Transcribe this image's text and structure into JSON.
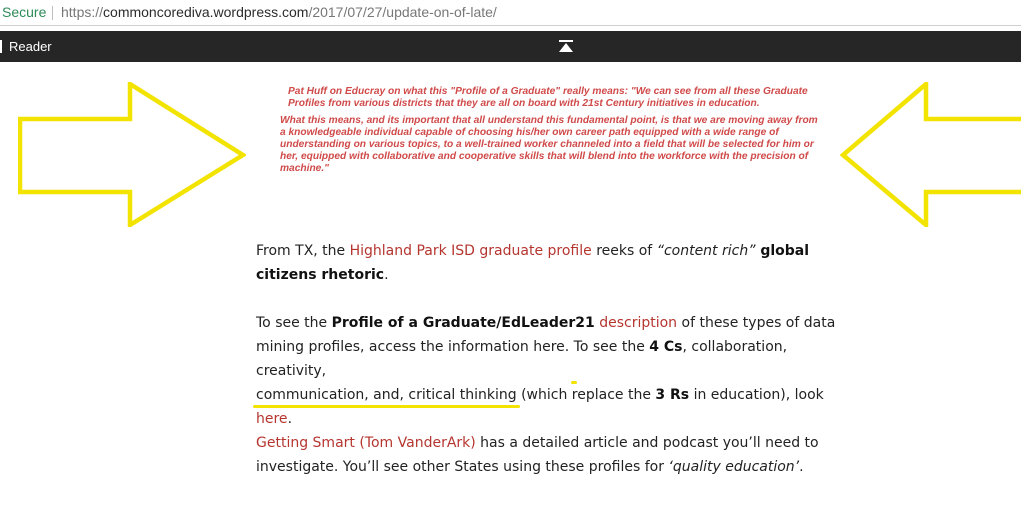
{
  "address_bar": {
    "secure_label": "Secure",
    "url_scheme": "https://",
    "url_host": "commoncorediva.wordpress.com",
    "url_path": "/2017/07/27/update-on-of-late/"
  },
  "reader_bar": {
    "label": "Reader",
    "collapse_icon": "collapse-up-icon"
  },
  "quote_image": {
    "paragraph1": "Pat Huff on Educray on what this \"Profile of a Graduate\" really means: \"We can see from all these Graduate Profiles from various districts that they are all on board with 21st Century initiatives in education.",
    "paragraph2": "What this means, and its important that all understand this fundamental point, is that we are moving away from a knowledgeable individual capable of choosing his/her own career path equipped with a wide range of understanding on various topics, to a well-trained worker channeled into a field that will be selected for him or her, equipped with collaborative and cooperative skills that will blend into the workforce with the precision of machine.\"",
    "text_color": "#d04a4a",
    "arrow_color": "#f2e300"
  },
  "article": {
    "p1": {
      "t1": "From TX, the ",
      "link1": "Highland Park ISD graduate profile",
      "t2": " reeks of ",
      "em1": "“content rich”",
      "bold1": " global citizens rhetoric",
      "t3": "."
    },
    "p2": {
      "t1": "To see the ",
      "bold1": "Profile of a Graduate/EdLeader21",
      "t2": " ",
      "link1": "description",
      "t3": " of these types of data mining profiles, access the information here. ",
      "u1": "To see the ",
      "u_bold": "4 Cs",
      "u2": ", collaboration, creativity,",
      "u3": "communication, and, critical thinking",
      "t4": " (which replace the ",
      "bold2": "3 Rs",
      "t5": " in education), look ",
      "link2": "here",
      "t6": ".",
      "link3": "Getting Smart (Tom VanderArk)",
      "t7": " has a detailed article and podcast you’ll need to investigate. You’ll see other States using these profiles for ",
      "em1": "‘quality education’",
      "t8": "."
    },
    "link_color": "#b5352f",
    "highlight_color": "#f2e300"
  }
}
